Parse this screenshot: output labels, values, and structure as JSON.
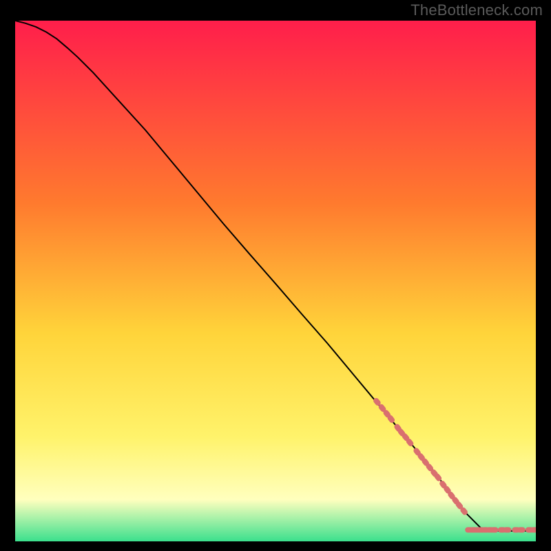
{
  "watermark": "TheBottleneck.com",
  "colors": {
    "page_bg": "#000000",
    "gradient_top": "#ff1e4b",
    "gradient_mid1": "#ff7a2e",
    "gradient_mid2": "#ffd43a",
    "gradient_mid3": "#fff36b",
    "gradient_mid4": "#ffffbe",
    "gradient_bottom": "#3be08d",
    "curve": "#000000",
    "dots": "#d96f6f"
  },
  "chart_data": {
    "type": "line",
    "x": [
      0.0,
      0.02,
      0.04,
      0.06,
      0.08,
      0.1,
      0.12,
      0.15,
      0.2,
      0.25,
      0.3,
      0.35,
      0.4,
      0.45,
      0.5,
      0.55,
      0.6,
      0.65,
      0.7,
      0.75,
      0.8,
      0.83,
      0.86,
      0.9,
      0.95,
      1.0
    ],
    "values": [
      1.0,
      0.995,
      0.988,
      0.978,
      0.965,
      0.948,
      0.93,
      0.9,
      0.845,
      0.79,
      0.73,
      0.67,
      0.61,
      0.552,
      0.495,
      0.437,
      0.38,
      0.32,
      0.26,
      0.2,
      0.14,
      0.1,
      0.06,
      0.02,
      0.02,
      0.02
    ],
    "xlim": [
      0,
      1
    ],
    "ylim": [
      0,
      1
    ],
    "xlabel": "",
    "ylabel": "",
    "title": "",
    "clusters": [
      {
        "comment": "upper dotted segment along the line",
        "points": [
          {
            "x": 0.695,
            "y": 0.268
          },
          {
            "x": 0.705,
            "y": 0.256
          },
          {
            "x": 0.714,
            "y": 0.245
          },
          {
            "x": 0.722,
            "y": 0.235
          },
          {
            "x": 0.735,
            "y": 0.218
          },
          {
            "x": 0.742,
            "y": 0.209
          },
          {
            "x": 0.75,
            "y": 0.2
          },
          {
            "x": 0.758,
            "y": 0.19
          },
          {
            "x": 0.772,
            "y": 0.172
          },
          {
            "x": 0.78,
            "y": 0.162
          },
          {
            "x": 0.788,
            "y": 0.152
          },
          {
            "x": 0.796,
            "y": 0.142
          },
          {
            "x": 0.805,
            "y": 0.131
          },
          {
            "x": 0.812,
            "y": 0.123
          },
          {
            "x": 0.822,
            "y": 0.109
          },
          {
            "x": 0.83,
            "y": 0.099
          },
          {
            "x": 0.838,
            "y": 0.088
          },
          {
            "x": 0.846,
            "y": 0.078
          },
          {
            "x": 0.853,
            "y": 0.069
          },
          {
            "x": 0.862,
            "y": 0.058
          }
        ]
      },
      {
        "comment": "lower horizontal tail dots",
        "points": [
          {
            "x": 0.872,
            "y": 0.022
          },
          {
            "x": 0.88,
            "y": 0.022
          },
          {
            "x": 0.888,
            "y": 0.022
          },
          {
            "x": 0.895,
            "y": 0.022
          },
          {
            "x": 0.903,
            "y": 0.022
          },
          {
            "x": 0.912,
            "y": 0.022
          },
          {
            "x": 0.92,
            "y": 0.022
          },
          {
            "x": 0.935,
            "y": 0.022
          },
          {
            "x": 0.945,
            "y": 0.022
          },
          {
            "x": 0.962,
            "y": 0.022
          },
          {
            "x": 0.972,
            "y": 0.022
          },
          {
            "x": 0.988,
            "y": 0.022
          },
          {
            "x": 0.997,
            "y": 0.022
          }
        ]
      }
    ]
  }
}
